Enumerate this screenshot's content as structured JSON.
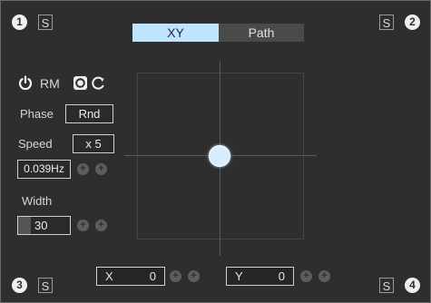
{
  "corners": {
    "tl": {
      "num": "1",
      "s": "S"
    },
    "tr": {
      "num": "2",
      "s": "S"
    },
    "bl": {
      "num": "3",
      "s": "S"
    },
    "br": {
      "num": "4",
      "s": "S"
    }
  },
  "tabs": [
    {
      "label": "XY",
      "active": true
    },
    {
      "label": "Path",
      "active": false
    }
  ],
  "controls": {
    "rm_label": "RM",
    "phase": {
      "label": "Phase",
      "value": "Rnd"
    },
    "speed": {
      "label": "Speed",
      "multiplier": "x 5",
      "value": "0.039Hz"
    },
    "width": {
      "label": "Width",
      "value": "30"
    },
    "plus_glyph": "+"
  },
  "pad": {
    "x": {
      "label": "X",
      "value": "0"
    },
    "y": {
      "label": "Y",
      "value": "0"
    }
  },
  "colors": {
    "accent": "#bfe4ff",
    "puck": "#d8ecfb",
    "background": "#2e2e2e"
  },
  "icons": {
    "power": "power-icon",
    "loop": "loop-icon",
    "reset": "reset-icon"
  }
}
